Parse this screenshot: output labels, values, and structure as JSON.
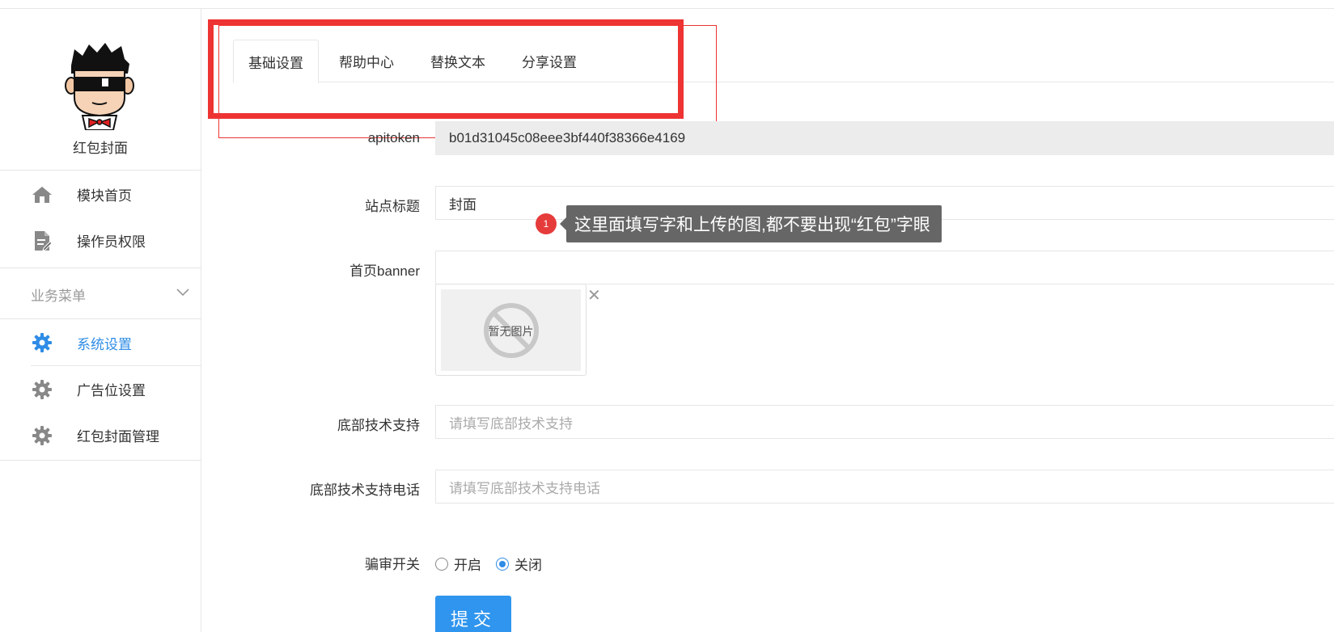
{
  "sidebar": {
    "brand": "红包封面",
    "items": [
      {
        "label": "模块首页",
        "icon": "home-icon"
      },
      {
        "label": "操作员权限",
        "icon": "document-edit-icon"
      }
    ],
    "section": {
      "label": "业务菜单",
      "icon": "chevron-down-icon"
    },
    "menu": [
      {
        "label": "系统设置",
        "icon": "gear-icon",
        "active": true
      },
      {
        "label": "广告位设置",
        "icon": "gear-icon"
      },
      {
        "label": "红包封面管理",
        "icon": "gear-icon"
      }
    ]
  },
  "tabs": [
    {
      "label": "基础设置",
      "active": true
    },
    {
      "label": "帮助中心"
    },
    {
      "label": "替换文本"
    },
    {
      "label": "分享设置"
    }
  ],
  "form": {
    "apitoken": {
      "label": "apitoken",
      "value": "b01d31045c08eee3bf440f38366e4169"
    },
    "site_title": {
      "label": "站点标题",
      "value": "封面"
    },
    "banner": {
      "label": "首页banner",
      "value": "",
      "empty_image_text": "暂无图片"
    },
    "footer_support": {
      "label": "底部技术支持",
      "placeholder": "请填写底部技术支持"
    },
    "footer_phone": {
      "label": "底部技术支持电话",
      "placeholder": "请填写底部技术支持电话"
    },
    "review_switch": {
      "label": "骗审开关",
      "options": [
        "开启",
        "关闭"
      ],
      "selected": "关闭"
    },
    "submit_label": "提交"
  },
  "annotation": {
    "badge": "1",
    "text": "这里面填写字和上传的图,都不要出现“红包”字眼"
  },
  "colors": {
    "accent": "#2f8ce6",
    "highlight": "#ee3333",
    "tooltip_bg": "#666666"
  }
}
